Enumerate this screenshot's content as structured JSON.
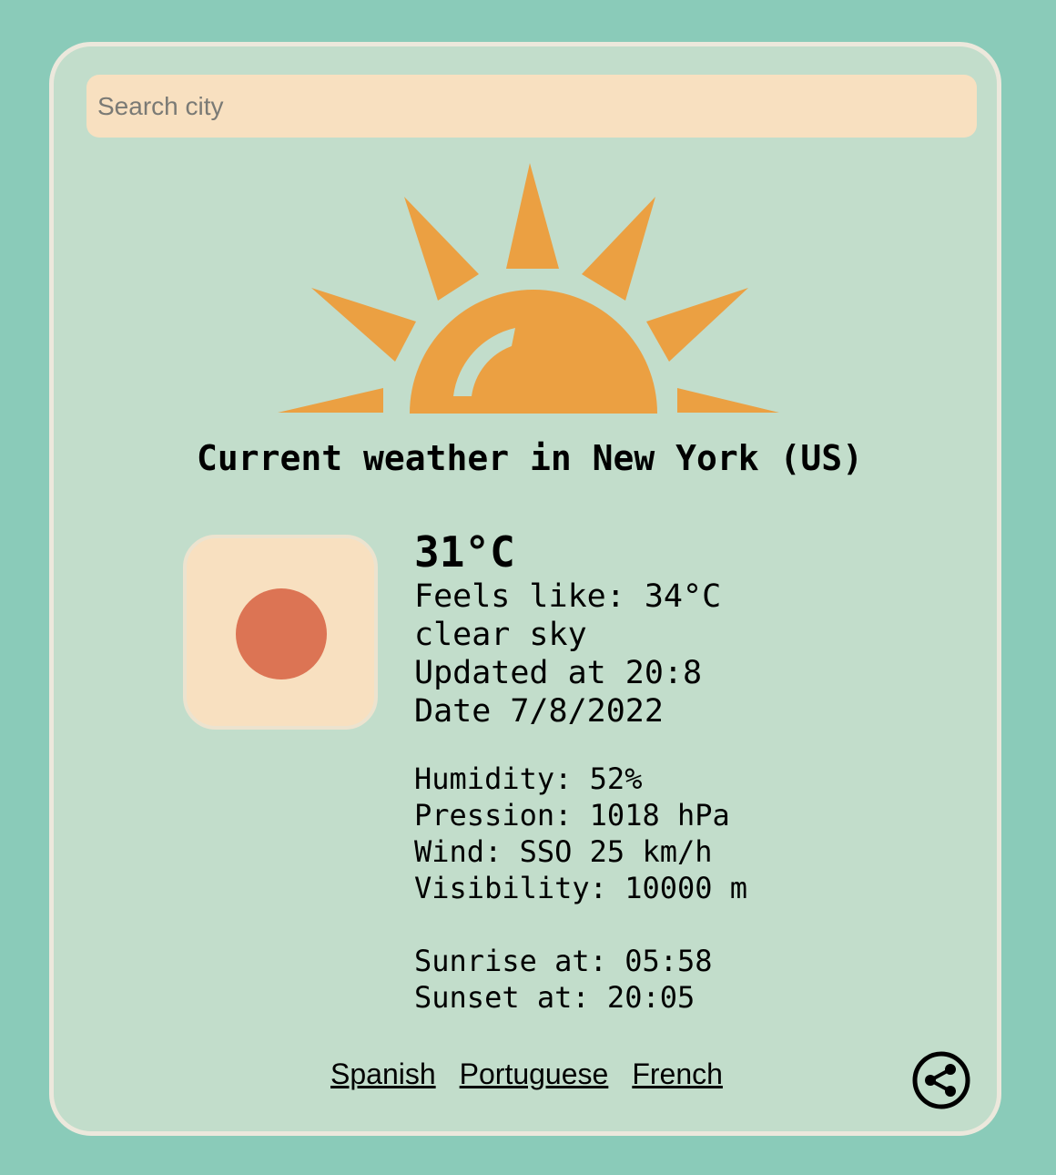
{
  "search": {
    "placeholder": "Search city",
    "value": ""
  },
  "weather": {
    "title": "Current weather in New York (US)",
    "temperature": "31°C",
    "feels_like": "Feels like: 34°C",
    "description": "clear sky",
    "updated": "Updated at 20:8",
    "date": "Date 7/8/2022",
    "icon": "sun-icon"
  },
  "details": {
    "humidity": "Humidity: 52%",
    "pressure": "Pression: 1018 hPa",
    "wind": "Wind: SSO 25 km/h",
    "visibility": "Visibility: 10000 m"
  },
  "sun": {
    "sunrise": "Sunrise at: 05:58",
    "sunset": "Sunset at: 20:05"
  },
  "languages": [
    "Spanish",
    "Portuguese",
    "French"
  ],
  "colors": {
    "page_background": "#8acbb9",
    "card_background": "#c2ddcb",
    "card_border": "#ece8dc",
    "search_background": "#f8e0c0",
    "sun_orange": "#eba042",
    "icon_dot": "#dc7454"
  },
  "hero": {
    "icon": "sunrise-illustration"
  },
  "share": {
    "icon": "share-icon"
  }
}
